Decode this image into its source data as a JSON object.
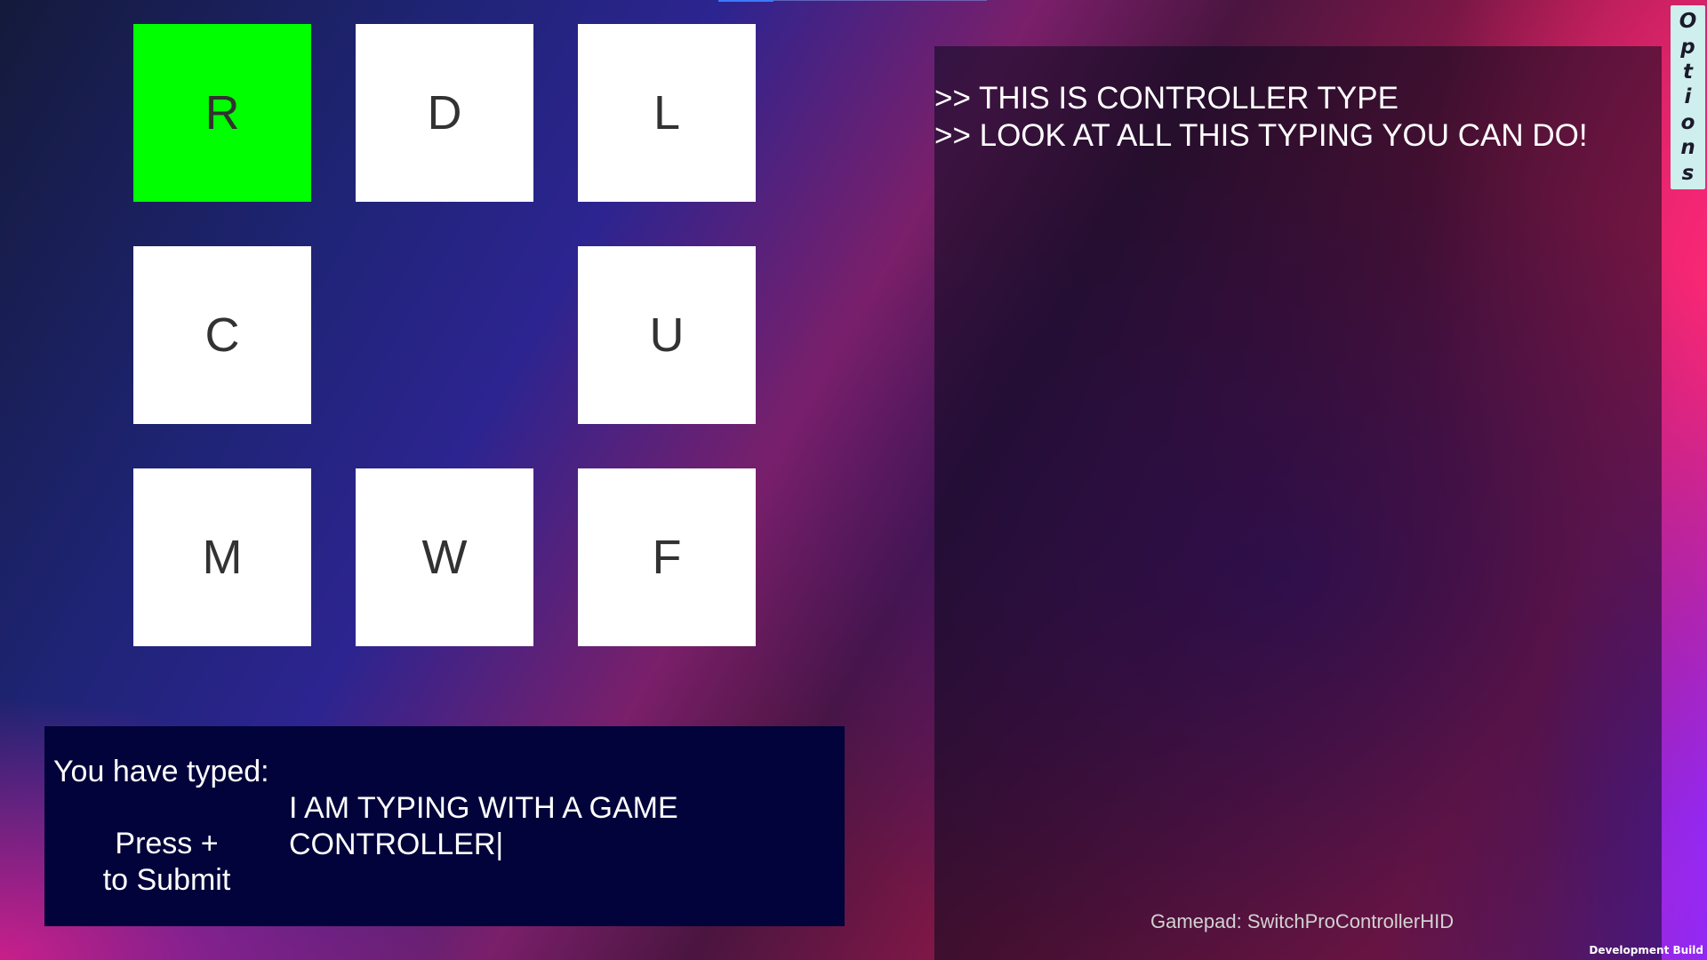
{
  "keyboard": {
    "tiles": [
      {
        "letter": "R",
        "selected": true
      },
      {
        "letter": "D",
        "selected": false
      },
      {
        "letter": "L",
        "selected": false
      },
      {
        "letter": "C",
        "selected": false
      },
      {
        "letter": "U",
        "selected": false
      },
      {
        "letter": "M",
        "selected": false
      },
      {
        "letter": "W",
        "selected": false
      },
      {
        "letter": "F",
        "selected": false
      }
    ],
    "selected_color": "#00ff00",
    "tile_color": "#ffffff"
  },
  "typed_panel": {
    "label": "You have typed:",
    "submit_hint": "Press +\nto Submit",
    "text": "I AM TYPING WITH A GAME CONTROLLER|"
  },
  "log_panel": {
    "lines": [
      ">> THIS IS CONTROLLER TYPE",
      ">> LOOK AT ALL THIS TYPING YOU CAN DO!"
    ],
    "gamepad_status": "Gamepad: SwitchProControllerHID"
  },
  "options": {
    "letters": [
      "O",
      "p",
      "t",
      "i",
      "o",
      "n",
      "s"
    ]
  },
  "build_label": "Development Build"
}
